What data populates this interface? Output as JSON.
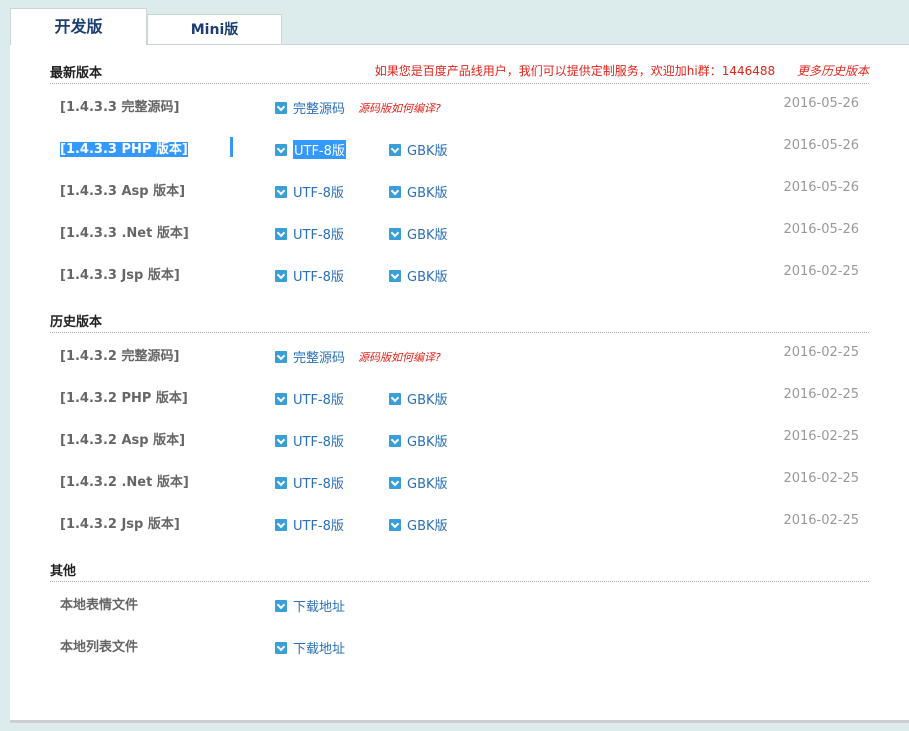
{
  "tabs": {
    "dev": "开发版",
    "mini": "Mini版"
  },
  "notice": {
    "text": "如果您是百度产品线用户，我们可以提供定制服务，欢迎加hi群：1446488",
    "more": "更多历史版本"
  },
  "sections": {
    "latest": "最新版本",
    "history": "历史版本",
    "other": "其他"
  },
  "labels": {
    "full_source": "完整源码",
    "compile_hint": "源码版如何编译?",
    "utf8": "UTF-8版",
    "gbk": "GBK版",
    "download": "下载地址"
  },
  "latest": [
    {
      "name": "[1.4.3.3 完整源码]",
      "date": "2016-05-26"
    },
    {
      "name": "[1.4.3.3 PHP 版本]",
      "date": "2016-05-26"
    },
    {
      "name": "[1.4.3.3 Asp 版本]",
      "date": "2016-05-26"
    },
    {
      "name": "[1.4.3.3 .Net 版本]",
      "date": "2016-05-26"
    },
    {
      "name": "[1.4.3.3 Jsp 版本]",
      "date": "2016-02-25"
    }
  ],
  "history": [
    {
      "name": "[1.4.3.2 完整源码]",
      "date": "2016-02-25"
    },
    {
      "name": "[1.4.3.2 PHP 版本]",
      "date": "2016-02-25"
    },
    {
      "name": "[1.4.3.2 Asp 版本]",
      "date": "2016-02-25"
    },
    {
      "name": "[1.4.3.2 .Net 版本]",
      "date": "2016-02-25"
    },
    {
      "name": "[1.4.3.2 Jsp 版本]",
      "date": "2016-02-25"
    }
  ],
  "other": [
    {
      "name": "本地表情文件"
    },
    {
      "name": "本地列表文件"
    }
  ],
  "colors": {
    "accent": "#2a6fb8",
    "notice": "#e2231a",
    "selection": "#3399ff"
  },
  "icons": {
    "link": "download-check-icon"
  }
}
